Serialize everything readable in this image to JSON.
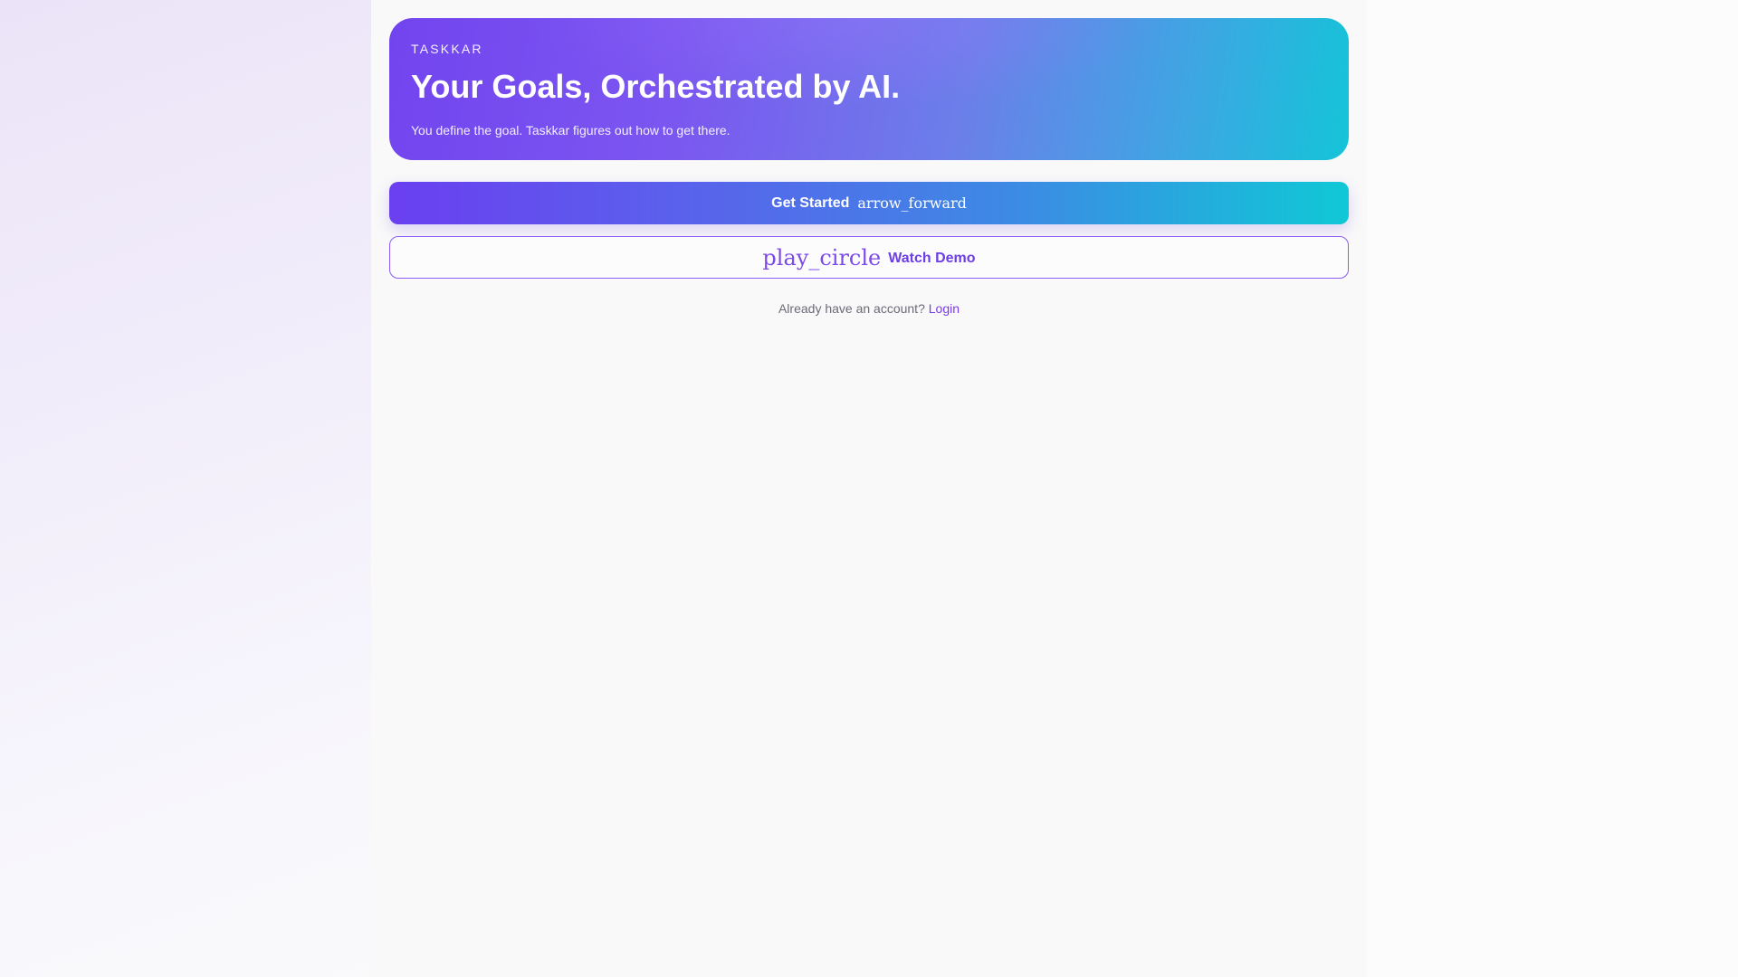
{
  "hero": {
    "brand": "TASKKAR",
    "headline": "Your Goals, Orchestrated by AI.",
    "tagline": "You define the goal. Taskkar figures out how to get there."
  },
  "actions": {
    "get_started_label": "Get Started",
    "get_started_icon": "arrow_forward",
    "watch_demo_icon": "play_circle",
    "watch_demo_label": "Watch Demo"
  },
  "account": {
    "prompt": "Already have an account?",
    "login_label": "Login"
  },
  "colors": {
    "accent_purple": "#7c3aed",
    "gradient_start": "#6a3ff0",
    "gradient_end": "#10c8d6"
  }
}
